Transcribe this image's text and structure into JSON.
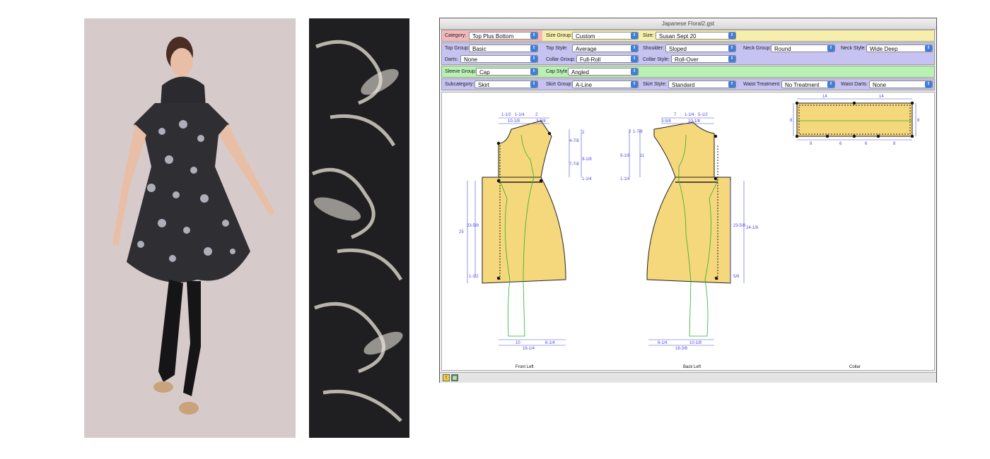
{
  "window": {
    "title": "Japanese Floral2.gst"
  },
  "row1": {
    "category_label": "Category:",
    "category_value": "Top Plus Bottom",
    "size_group_label": "Size Group:",
    "size_group_value": "Custom",
    "size_label": "Size:",
    "size_value": "Susan Sept 20"
  },
  "row2": {
    "top_group_label": "Top Group:",
    "top_group_value": "Basic",
    "top_style_label": "Top Style:",
    "top_style_value": "Average",
    "shoulder_label": "Shoulder:",
    "shoulder_value": "Sloped",
    "neck_group_label": "Neck Group:",
    "neck_group_value": "Round",
    "neck_style_label": "Neck Style:",
    "neck_style_value": "Wide Deep",
    "darts_label": "Darts:",
    "darts_value": "None",
    "collar_group_label": "Collar Group:",
    "collar_group_value": "Full-Roll",
    "collar_style_label": "Collar Style:",
    "collar_style_value": "Roll-Over"
  },
  "row3": {
    "sleeve_group_label": "Sleeve Group:",
    "sleeve_group_value": "Cap",
    "cap_style_label": "Cap Style:",
    "cap_style_value": "Angled"
  },
  "row4": {
    "subcategory_label": "Subcategory:",
    "subcategory_value": "Skirt",
    "skirt_group_label": "Skirt Group:",
    "skirt_group_value": "A-Line",
    "skirt_style_label": "Skirt Style:",
    "skirt_style_value": "Standard",
    "waist_treatment_label": "Waist Treatment:",
    "waist_treatment_value": "No Treatment",
    "waist_darts_label": "Waist Darts:",
    "waist_darts_value": "None"
  },
  "pattern": {
    "front": {
      "caption": "Front Left",
      "top_dims": [
        "1-1/2",
        "1-1/4",
        "2",
        "10-1/8",
        "3-5/8"
      ],
      "right_dims": [
        "2",
        "4-7/8",
        "9-1/8",
        "7-7/8",
        "1-1/4"
      ],
      "left_dims": [
        "25",
        "23-5/8",
        "1-1/2"
      ],
      "bottom_dims": [
        "10",
        "6-1/4",
        "16-1/4"
      ]
    },
    "back": {
      "caption": "Back Left",
      "top_dims": [
        "7",
        "1-1/4",
        "5-1/2",
        "3-5/8",
        "10-1/8"
      ],
      "left_dims": [
        "1-7/8",
        "2",
        "9-1/8",
        "11",
        "1-1/4"
      ],
      "right_dims": [
        "23-5/8",
        "24-1/8",
        "5/8"
      ],
      "bottom_dims": [
        "6-1/4",
        "10-1/8",
        "16-3/8"
      ]
    },
    "collar": {
      "caption": "Collar",
      "top_dims": [
        "14",
        "14"
      ],
      "side_dims": [
        "8",
        "8"
      ],
      "bottom_dims": [
        "8",
        "6",
        "6",
        "8"
      ]
    }
  },
  "colors": {
    "row1_bg": "#f6eeab",
    "category_bg": "#f4b8bc",
    "row2_bg": "#c6c3f2",
    "row3_bg": "#b9f0b3",
    "row4_bg": "#c6c3f2",
    "piece_fill": "#f5d77c",
    "dim_color": "#4b4be0",
    "green_line": "#2db02d"
  },
  "icons": {
    "status_left": "warning-icon",
    "status_right": "grid-icon"
  }
}
